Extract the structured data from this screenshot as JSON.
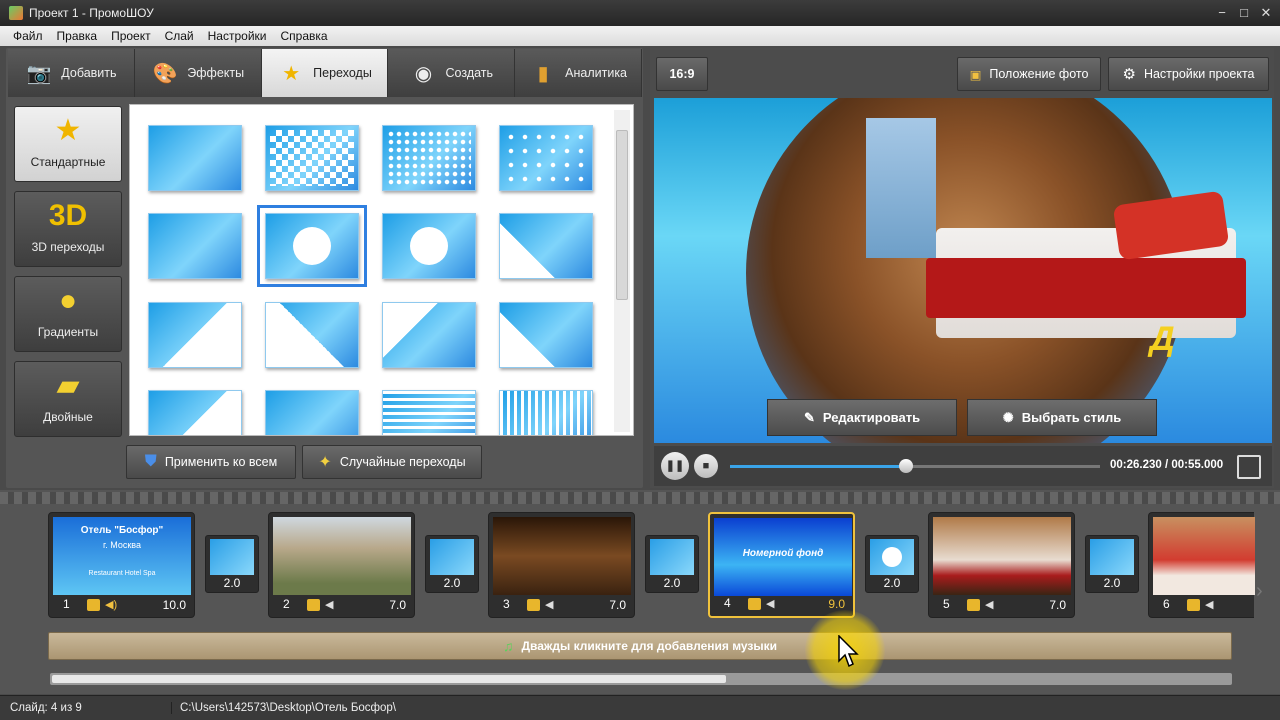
{
  "window": {
    "title": "Проект 1 - ПромоШОУ",
    "minimize": "−",
    "maximize": "□",
    "close": "✕"
  },
  "menu": [
    "Файл",
    "Правка",
    "Проект",
    "Слай",
    "Настройки",
    "Справка"
  ],
  "tabs": [
    {
      "label": "Добавить",
      "icon": "camera-icon"
    },
    {
      "label": "Эффекты",
      "icon": "palette-icon"
    },
    {
      "label": "Переходы",
      "icon": "star-icon",
      "active": true
    },
    {
      "label": "Создать",
      "icon": "film-reel-icon"
    },
    {
      "label": "Аналитика",
      "icon": "bar-chart-icon"
    }
  ],
  "categories": [
    {
      "label": "Стандартные",
      "icon": "star-icon",
      "active": true
    },
    {
      "label": "3D переходы",
      "icon": "3d-icon",
      "glyph": "3D"
    },
    {
      "label": "Градиенты",
      "icon": "gradient-icon"
    },
    {
      "label": "Двойные",
      "icon": "double-icon"
    }
  ],
  "transitions_panel": {
    "apply_all_label": "Применить ко всем",
    "random_label": "Случайные переходы"
  },
  "preview": {
    "ratio_label": "16:9",
    "photo_position_label": "Положение фото",
    "project_settings_label": "Настройки проекта",
    "edit_label": "Редактировать",
    "style_label": "Выбрать стиль",
    "overlay_text": "Д"
  },
  "player": {
    "time": "00:26.230 / 00:55.000",
    "progress": 0.476
  },
  "timeline": {
    "slides": [
      {
        "num": "1",
        "duration": "10.0",
        "title": "Отель \"Босфор\"",
        "subtitle": "г. Москва",
        "footer": "Restaurant Hotel Spa"
      },
      {
        "num": "2",
        "duration": "7.0"
      },
      {
        "num": "3",
        "duration": "7.0"
      },
      {
        "num": "4",
        "duration": "9.0",
        "caption": "Номерной фонд",
        "selected": true
      },
      {
        "num": "5",
        "duration": "7.0"
      },
      {
        "num": "6",
        "duration": ""
      }
    ],
    "transitions": [
      "2.0",
      "2.0",
      "2.0",
      "2.0",
      "2.0"
    ],
    "music_hint": "Дважды кликните для добавления музыки"
  },
  "status": {
    "slide_info": "Слайд: 4 из 9",
    "path": "C:\\Users\\142573\\Desktop\\Отель Босфор\\"
  },
  "colors": {
    "accent": "#2f7fe0",
    "selected_slide": "#f0c23c",
    "sky": "#1c9fd8"
  }
}
